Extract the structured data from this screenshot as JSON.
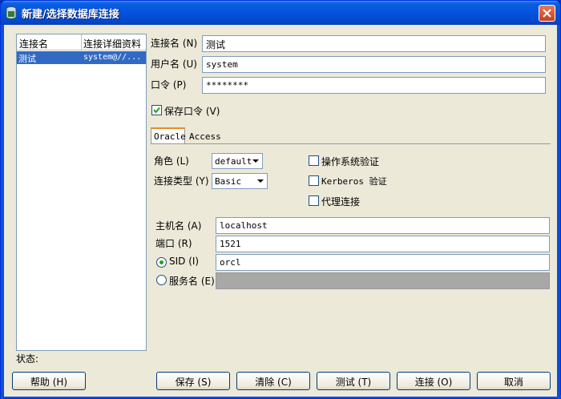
{
  "window": {
    "title": "新建/选择数据库连接",
    "colors": {
      "titlebar": "#0553dd",
      "client": "#ece9d8",
      "selection": "#316ac5",
      "disabled_field": "#a8a8a8"
    }
  },
  "connections": {
    "headers": [
      "连接名",
      "连接详细资料"
    ],
    "rows": [
      {
        "name": "测试",
        "details": "system@//..."
      }
    ]
  },
  "status_label": "状态:",
  "form": {
    "conn_name": {
      "label": "连接名 (N)",
      "value": "测试"
    },
    "username": {
      "label": "用户名 (U)",
      "value": "system"
    },
    "password": {
      "label": "口令 (P)",
      "value": "********"
    },
    "save_password": {
      "label": "保存口令 (V)",
      "checked": true
    }
  },
  "tabs": [
    "Oracle",
    "Access"
  ],
  "oracle": {
    "role": {
      "label": "角色 (L)",
      "value": "default"
    },
    "conn_type": {
      "label": "连接类型 (Y)",
      "value": "Basic"
    },
    "os_auth": {
      "label": "操作系统验证",
      "checked": false
    },
    "kerberos": {
      "label": "Kerberos 验证",
      "checked": false
    },
    "proxy": {
      "label": "代理连接",
      "checked": false
    },
    "host": {
      "label": "主机名 (A)",
      "value": "localhost"
    },
    "port": {
      "label": "端口 (R)",
      "value": "1521"
    },
    "sid": {
      "label": "SID (I)",
      "value": "orcl",
      "selected": true
    },
    "service": {
      "label": "服务名 (E)",
      "value": "",
      "selected": false
    }
  },
  "buttons": {
    "help": "帮助 (H)",
    "save": "保存 (S)",
    "clear": "清除 (C)",
    "test": "测试 (T)",
    "connect": "连接 (O)",
    "cancel": "取消"
  },
  "icons": {
    "app": "database-icon",
    "close": "close-icon",
    "check": "check-icon",
    "dropdown": "chevron-down-icon"
  }
}
